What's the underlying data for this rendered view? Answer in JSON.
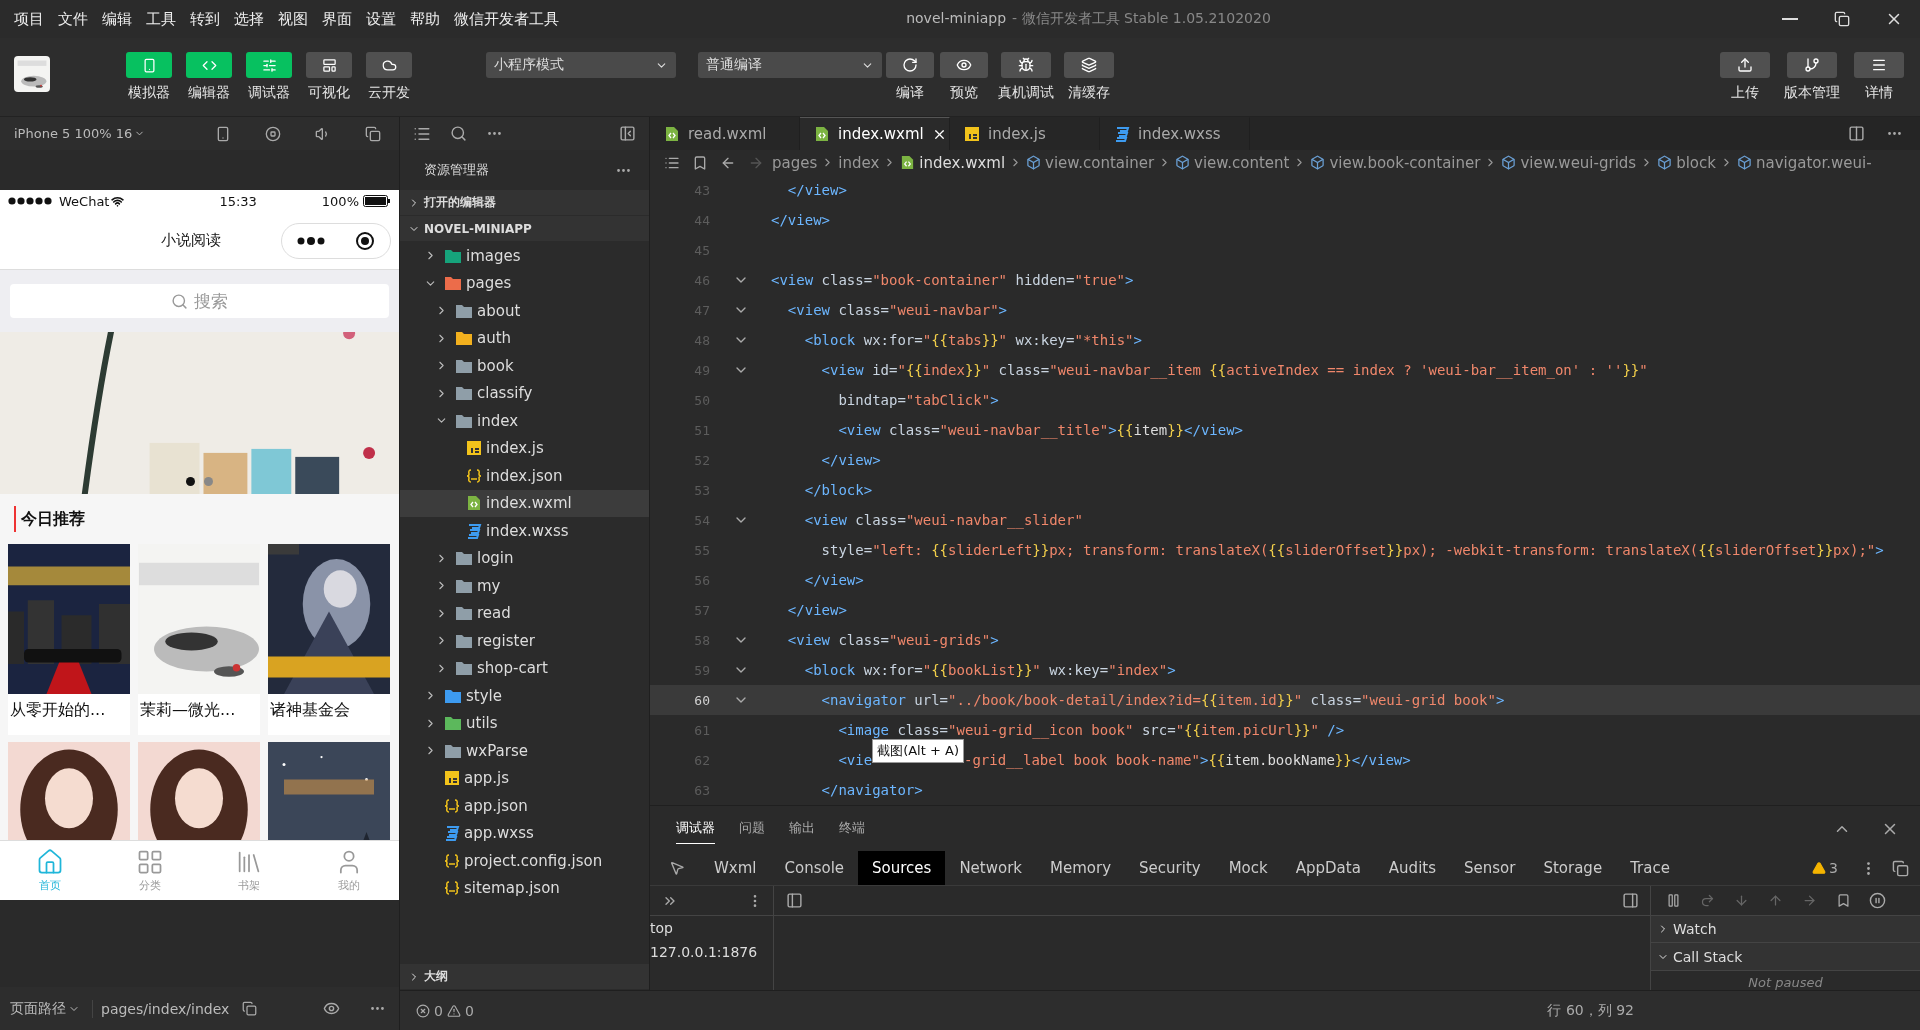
{
  "menu": [
    "项目",
    "文件",
    "编辑",
    "工具",
    "转到",
    "选择",
    "视图",
    "界面",
    "设置",
    "帮助",
    "微信开发者工具"
  ],
  "window": {
    "title": "novel-miniapp",
    "subtitle": "- 微信开发者工具 Stable 1.05.2102020"
  },
  "toolbar": {
    "views": [
      {
        "label": "模拟器",
        "on": true
      },
      {
        "label": "编辑器",
        "on": true
      },
      {
        "label": "调试器",
        "on": true
      },
      {
        "label": "可视化",
        "on": false
      },
      {
        "label": "云开发",
        "on": false
      }
    ],
    "mode": "小程序模式",
    "compile": "普通编译",
    "actions": [
      "编译",
      "预览",
      "真机调试",
      "清缓存"
    ],
    "right_actions": [
      "上传",
      "版本管理",
      "详情"
    ]
  },
  "simulator": {
    "device": "iPhone 5 100% 16",
    "phone": {
      "carrier": "WeChat",
      "time": "15:33",
      "battery": "100%",
      "title": "小说阅读",
      "search_placeholder": "搜索",
      "banner": {
        "kind": "picture",
        "dots": [
          {
            "selected": true
          },
          {
            "selected": false
          }
        ]
      },
      "section_title": "今日推荐",
      "books": [
        {
          "kind": "picture",
          "title": "从零开始的..."
        },
        {
          "kind": "picture",
          "title": "茉莉—微光..."
        },
        {
          "kind": "picture",
          "title": "诸神基金会"
        },
        {
          "kind": "picture"
        },
        {
          "kind": "picture"
        },
        {
          "kind": "picture"
        }
      ],
      "tabbar": [
        {
          "label": "首页",
          "selected": true
        },
        {
          "label": "分类",
          "selected": false
        },
        {
          "label": "书架",
          "selected": false
        },
        {
          "label": "我的",
          "selected": false
        }
      ]
    },
    "footer": {
      "label": "页面路径",
      "path": "pages/index/index"
    }
  },
  "explorer": {
    "title": "资源管理器",
    "open_editors": {
      "label": "打开的编辑器",
      "expanded": false
    },
    "project": {
      "label": "NOVEL-MINIAPP",
      "expanded": true,
      "tree": [
        {
          "name": "images",
          "kind": "folder-images",
          "expanded": false,
          "selected": false
        },
        {
          "name": "pages",
          "kind": "folder-pages",
          "expanded": true,
          "selected": false,
          "children": [
            {
              "name": "about",
              "kind": "folder",
              "expanded": false,
              "selected": false
            },
            {
              "name": "auth",
              "kind": "folder-auth",
              "expanded": false,
              "selected": false
            },
            {
              "name": "book",
              "kind": "folder",
              "expanded": false,
              "selected": false
            },
            {
              "name": "classify",
              "kind": "folder",
              "expanded": false,
              "selected": false
            },
            {
              "name": "index",
              "kind": "folder",
              "expanded": true,
              "selected": false,
              "children": [
                {
                  "name": "index.js",
                  "kind": "js",
                  "expanded": false,
                  "selected": false
                },
                {
                  "name": "index.json",
                  "kind": "json",
                  "expanded": false,
                  "selected": false
                },
                {
                  "name": "index.wxml",
                  "kind": "wxml",
                  "expanded": false,
                  "selected": true
                },
                {
                  "name": "index.wxss",
                  "kind": "wxss",
                  "expanded": false,
                  "selected": false
                }
              ]
            },
            {
              "name": "login",
              "kind": "folder",
              "expanded": false,
              "selected": false
            },
            {
              "name": "my",
              "kind": "folder",
              "expanded": false,
              "selected": false
            },
            {
              "name": "read",
              "kind": "folder",
              "expanded": false,
              "selected": false
            },
            {
              "name": "register",
              "kind": "folder",
              "expanded": false,
              "selected": false
            },
            {
              "name": "shop-cart",
              "kind": "folder",
              "expanded": false,
              "selected": false
            }
          ]
        },
        {
          "name": "style",
          "kind": "folder-style",
          "expanded": false,
          "selected": false
        },
        {
          "name": "utils",
          "kind": "folder-utils",
          "expanded": false,
          "selected": false
        },
        {
          "name": "wxParse",
          "kind": "folder",
          "expanded": false,
          "selected": false
        },
        {
          "name": "app.js",
          "kind": "js",
          "expanded": false,
          "selected": false
        },
        {
          "name": "app.json",
          "kind": "json",
          "expanded": false,
          "selected": false
        },
        {
          "name": "app.wxss",
          "kind": "wxss",
          "expanded": false,
          "selected": false
        },
        {
          "name": "project.config.json",
          "kind": "json",
          "expanded": false,
          "selected": false
        },
        {
          "name": "sitemap.json",
          "kind": "json",
          "expanded": false,
          "selected": false
        }
      ]
    },
    "outline": {
      "label": "大纲",
      "expanded": false
    }
  },
  "editor": {
    "tabs": [
      {
        "label": "read.wxml",
        "kind": "wxml",
        "selected": false
      },
      {
        "label": "index.wxml",
        "kind": "wxml",
        "selected": true
      },
      {
        "label": "index.js",
        "kind": "js",
        "selected": false
      },
      {
        "label": "index.wxss",
        "kind": "wxss",
        "selected": false
      }
    ],
    "breadcrumb": [
      {
        "label": "pages",
        "kind": "folder"
      },
      {
        "label": "index",
        "kind": "folder"
      },
      {
        "label": "index.wxml",
        "kind": "wxml"
      },
      {
        "label": "view.container",
        "kind": "element"
      },
      {
        "label": "view.content",
        "kind": "element"
      },
      {
        "label": "view.book-container",
        "kind": "element"
      },
      {
        "label": "view.weui-grids",
        "kind": "element"
      },
      {
        "label": "block",
        "kind": "element"
      },
      {
        "label": "navigator.weui-",
        "kind": "element"
      }
    ],
    "lines": [
      {
        "number": "43",
        "foldable": false,
        "selected": false,
        "tokens": [
          {
            "kind": "tag",
            "text": "  </view>"
          }
        ]
      },
      {
        "number": "44",
        "foldable": false,
        "selected": false,
        "tokens": [
          {
            "kind": "tag",
            "text": "</view>"
          }
        ]
      },
      {
        "number": "45",
        "foldable": false,
        "selected": false
      },
      {
        "number": "46",
        "foldable": true,
        "selected": false,
        "tokens": [
          {
            "kind": "tag",
            "text": "<view"
          },
          {
            "kind": "attr",
            "text": " class="
          },
          {
            "kind": "str",
            "text": "\"book-container\""
          },
          {
            "kind": "attr",
            "text": " hidden="
          },
          {
            "kind": "str",
            "text": "\"true\""
          },
          {
            "kind": "tag",
            "text": ">"
          }
        ]
      },
      {
        "number": "47",
        "foldable": true,
        "selected": false,
        "tokens": [
          {
            "kind": "tag",
            "text": "  <view"
          },
          {
            "kind": "attr",
            "text": " class="
          },
          {
            "kind": "str",
            "text": "\"weui-navbar\""
          },
          {
            "kind": "tag",
            "text": ">"
          }
        ]
      },
      {
        "number": "48",
        "foldable": true,
        "selected": false,
        "tokens": [
          {
            "kind": "tag",
            "text": "    <block"
          },
          {
            "kind": "attr",
            "text": " wx:for="
          },
          {
            "kind": "str",
            "text": "\""
          },
          {
            "kind": "brace",
            "text": "{{"
          },
          {
            "kind": "str",
            "text": "tabs"
          },
          {
            "kind": "brace",
            "text": "}}"
          },
          {
            "kind": "str",
            "text": "\""
          },
          {
            "kind": "attr",
            "text": " wx:key="
          },
          {
            "kind": "str",
            "text": "\"*this\""
          },
          {
            "kind": "tag",
            "text": ">"
          }
        ]
      },
      {
        "number": "49",
        "foldable": true,
        "selected": false,
        "tokens": [
          {
            "kind": "tag",
            "text": "      <view"
          },
          {
            "kind": "attr",
            "text": " id="
          },
          {
            "kind": "str",
            "text": "\""
          },
          {
            "kind": "brace",
            "text": "{{"
          },
          {
            "kind": "str",
            "text": "index"
          },
          {
            "kind": "brace",
            "text": "}}"
          },
          {
            "kind": "str",
            "text": "\""
          },
          {
            "kind": "attr",
            "text": " class="
          },
          {
            "kind": "str",
            "text": "\"weui-navbar__item "
          },
          {
            "kind": "brace",
            "text": "{{"
          },
          {
            "kind": "str",
            "text": "activeIndex == index ? 'weui-bar__item_on' : ''"
          },
          {
            "kind": "brace",
            "text": "}}"
          },
          {
            "kind": "str",
            "text": "\""
          }
        ]
      },
      {
        "number": "50",
        "foldable": false,
        "selected": false,
        "tokens": [
          {
            "kind": "attr",
            "text": "        bindtap="
          },
          {
            "kind": "str",
            "text": "\"tabClick\""
          },
          {
            "kind": "tag",
            "text": ">"
          }
        ]
      },
      {
        "number": "51",
        "foldable": false,
        "selected": false,
        "tokens": [
          {
            "kind": "tag",
            "text": "        <view"
          },
          {
            "kind": "attr",
            "text": " class="
          },
          {
            "kind": "str",
            "text": "\"weui-navbar__title\""
          },
          {
            "kind": "tag",
            "text": ">"
          },
          {
            "kind": "brace",
            "text": "{{"
          },
          {
            "kind": "plain",
            "text": "item"
          },
          {
            "kind": "brace",
            "text": "}}"
          },
          {
            "kind": "tag",
            "text": "</view>"
          }
        ]
      },
      {
        "number": "52",
        "foldable": false,
        "selected": false,
        "tokens": [
          {
            "kind": "tag",
            "text": "      </view>"
          }
        ]
      },
      {
        "number": "53",
        "foldable": false,
        "selected": false,
        "tokens": [
          {
            "kind": "tag",
            "text": "    </block>"
          }
        ]
      },
      {
        "number": "54",
        "foldable": true,
        "selected": false,
        "tokens": [
          {
            "kind": "tag",
            "text": "    <view"
          },
          {
            "kind": "attr",
            "text": " class="
          },
          {
            "kind": "str",
            "text": "\"weui-navbar__slider\""
          }
        ]
      },
      {
        "number": "55",
        "foldable": false,
        "selected": false,
        "tokens": [
          {
            "kind": "attr",
            "text": "      style="
          },
          {
            "kind": "str",
            "text": "\"left: "
          },
          {
            "kind": "brace",
            "text": "{{"
          },
          {
            "kind": "str",
            "text": "sliderLeft"
          },
          {
            "kind": "brace",
            "text": "}}"
          },
          {
            "kind": "str",
            "text": "px; transform: translateX("
          },
          {
            "kind": "brace",
            "text": "{{"
          },
          {
            "kind": "str",
            "text": "sliderOffset"
          },
          {
            "kind": "brace",
            "text": "}}"
          },
          {
            "kind": "str",
            "text": "px); -webkit-transform: translateX("
          },
          {
            "kind": "brace",
            "text": "{{"
          },
          {
            "kind": "str",
            "text": "sliderOffset"
          },
          {
            "kind": "brace",
            "text": "}}"
          },
          {
            "kind": "str",
            "text": "px);\""
          },
          {
            "kind": "tag",
            "text": ">"
          }
        ]
      },
      {
        "number": "56",
        "foldable": false,
        "selected": false,
        "tokens": [
          {
            "kind": "tag",
            "text": "    </view>"
          }
        ]
      },
      {
        "number": "57",
        "foldable": false,
        "selected": false,
        "tokens": [
          {
            "kind": "tag",
            "text": "  </view>"
          }
        ]
      },
      {
        "number": "58",
        "foldable": true,
        "selected": false,
        "tokens": [
          {
            "kind": "tag",
            "text": "  <view"
          },
          {
            "kind": "attr",
            "text": " class="
          },
          {
            "kind": "str",
            "text": "\"weui-grids\""
          },
          {
            "kind": "tag",
            "text": ">"
          }
        ]
      },
      {
        "number": "59",
        "foldable": true,
        "selected": false,
        "tokens": [
          {
            "kind": "tag",
            "text": "    <block"
          },
          {
            "kind": "attr",
            "text": " wx:for="
          },
          {
            "kind": "str",
            "text": "\""
          },
          {
            "kind": "brace",
            "text": "{{"
          },
          {
            "kind": "str",
            "text": "bookList"
          },
          {
            "kind": "brace",
            "text": "}}"
          },
          {
            "kind": "str",
            "text": "\""
          },
          {
            "kind": "attr",
            "text": " wx:key="
          },
          {
            "kind": "str",
            "text": "\"index\""
          },
          {
            "kind": "tag",
            "text": ">"
          }
        ]
      },
      {
        "number": "60",
        "foldable": true,
        "selected": true,
        "tokens": [
          {
            "kind": "tag",
            "text": "      <navigator"
          },
          {
            "kind": "attr",
            "text": " url="
          },
          {
            "kind": "str",
            "text": "\"../book/book-detail/index?id="
          },
          {
            "kind": "brace",
            "text": "{{"
          },
          {
            "kind": "str",
            "text": "item.id"
          },
          {
            "kind": "brace",
            "text": "}}"
          },
          {
            "kind": "str",
            "text": "\""
          },
          {
            "kind": "attr",
            "text": " class="
          },
          {
            "kind": "str",
            "text": "\"weui-grid book\""
          },
          {
            "kind": "tag",
            "text": ">"
          }
        ]
      },
      {
        "number": "61",
        "foldable": false,
        "selected": false,
        "tokens": [
          {
            "kind": "tag",
            "text": "        <image"
          },
          {
            "kind": "attr",
            "text": " class="
          },
          {
            "kind": "str",
            "text": "\"weui-grid__icon book\""
          },
          {
            "kind": "attr",
            "text": " src="
          },
          {
            "kind": "str",
            "text": "\""
          },
          {
            "kind": "brace",
            "text": "{{"
          },
          {
            "kind": "str",
            "text": "item.picUrl"
          },
          {
            "kind": "brace",
            "text": "}}"
          },
          {
            "kind": "str",
            "text": "\""
          },
          {
            "kind": "tag",
            "text": " />"
          }
        ]
      },
      {
        "number": "62",
        "foldable": false,
        "selected": false,
        "tokens": [
          {
            "kind": "tag",
            "text": "        <vie"
          }
        ],
        "tooltip": "截图(Alt + A)",
        "tokens_after": [
          {
            "kind": "str",
            "text": "-grid__label book book-name\""
          },
          {
            "kind": "tag",
            "text": ">"
          },
          {
            "kind": "brace",
            "text": "{{"
          },
          {
            "kind": "plain",
            "text": "item.bookName"
          },
          {
            "kind": "brace",
            "text": "}}"
          },
          {
            "kind": "tag",
            "text": "</view>"
          }
        ]
      },
      {
        "number": "63",
        "foldable": false,
        "selected": false,
        "tokens": [
          {
            "kind": "tag",
            "text": "      </navigator>"
          }
        ]
      }
    ]
  },
  "devtools": {
    "panels": [
      {
        "label": "调试器",
        "selected": true
      },
      {
        "label": "问题",
        "selected": false
      },
      {
        "label": "输出",
        "selected": false
      },
      {
        "label": "终端",
        "selected": false
      }
    ],
    "tabs": [
      {
        "label": "Wxml",
        "selected": false
      },
      {
        "label": "Console",
        "selected": false
      },
      {
        "label": "Sources",
        "selected": true
      },
      {
        "label": "Network",
        "selected": false
      },
      {
        "label": "Memory",
        "selected": false
      },
      {
        "label": "Security",
        "selected": false
      },
      {
        "label": "Mock",
        "selected": false
      },
      {
        "label": "AppData",
        "selected": false
      },
      {
        "label": "Audits",
        "selected": false
      },
      {
        "label": "Sensor",
        "selected": false
      },
      {
        "label": "Storage",
        "selected": false
      },
      {
        "label": "Trace",
        "selected": false
      }
    ],
    "warnings": "3",
    "frames": [
      "top",
      "127.0.0.1:1876"
    ],
    "sidebar": [
      {
        "label": "Watch",
        "expanded": false
      },
      {
        "label": "Call Stack",
        "expanded": true,
        "note": "Not paused"
      }
    ]
  },
  "status": {
    "errors": "0",
    "warnings": "0",
    "position": "行 60，列 92"
  }
}
